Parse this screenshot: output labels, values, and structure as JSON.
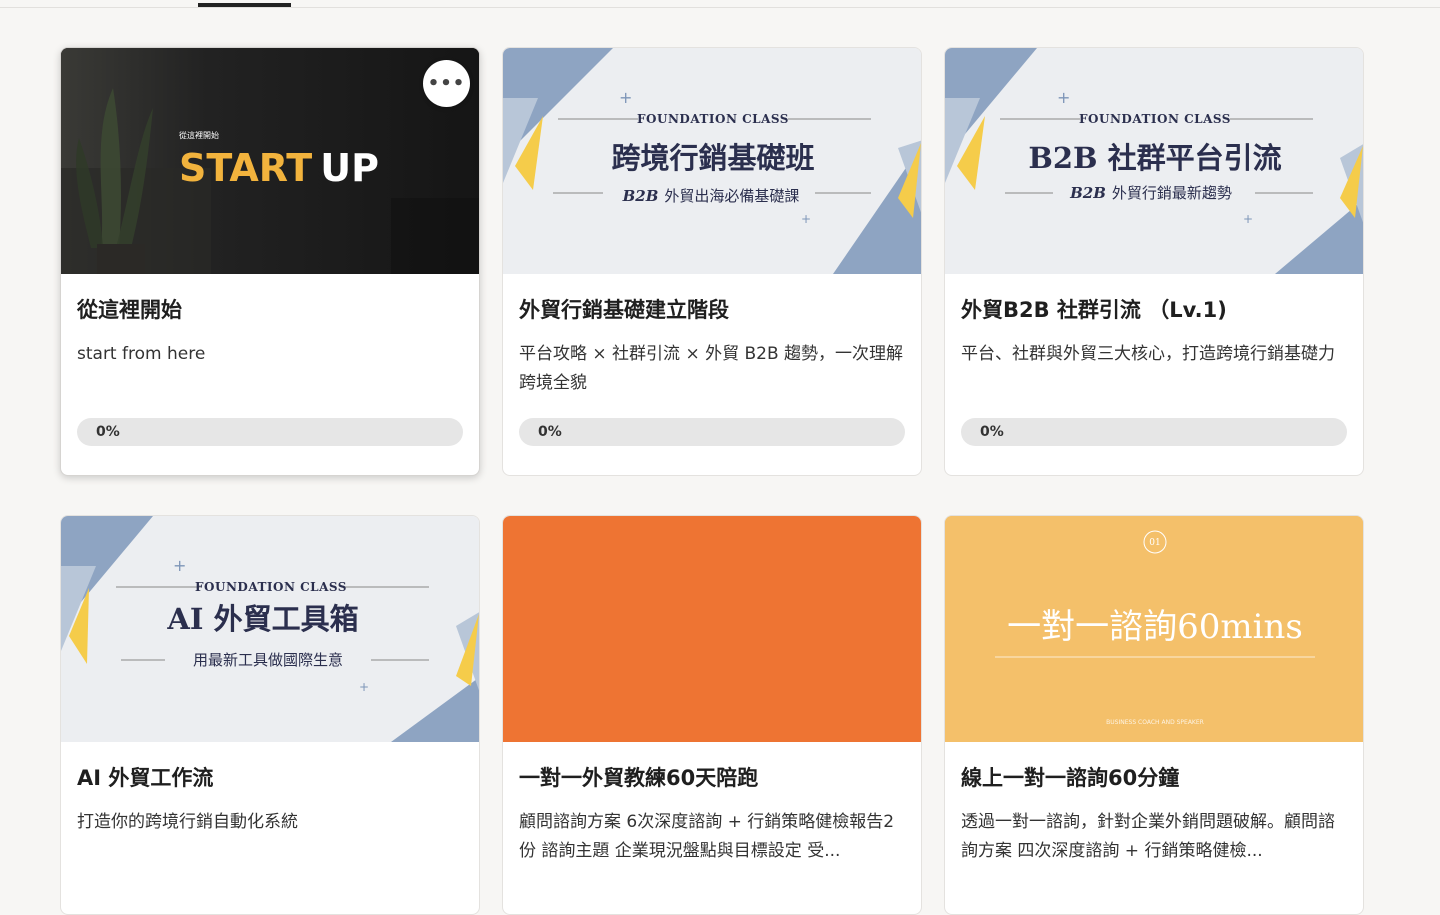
{
  "courses": [
    {
      "title": "從這裡開始",
      "description": "start from here",
      "progress_label": "0%",
      "progress": 0,
      "more_label": "•••",
      "thumb": {
        "kicker": "從這裡開始",
        "word1": "START",
        "word2": "UP"
      }
    },
    {
      "title": "外貿行銷基礎建立階段",
      "description": "平台攻略 × 社群引流 × 外貿 B2B 趨勢，一次理解跨境全貌",
      "progress_label": "0%",
      "progress": 0,
      "thumb": {
        "kicker": "FOUNDATION CLASS",
        "headline": "跨境行銷基礎班",
        "sub_bold": "B2B",
        "sub": "外貿出海必備基礎課"
      }
    },
    {
      "title": "外貿B2B 社群引流 （Lv.1)",
      "description": "平台、社群與外貿三大核心，打造跨境行銷基礎力",
      "progress_label": "0%",
      "progress": 0,
      "thumb": {
        "kicker": "FOUNDATION CLASS",
        "headline": "B2B 社群平台引流",
        "sub_bold": "B2B",
        "sub": "外貿行銷最新趨勢"
      }
    },
    {
      "title": "AI 外貿工作流",
      "description": "打造你的跨境行銷自動化系統",
      "thumb": {
        "kicker": "FOUNDATION CLASS",
        "headline": "AI 外貿工具箱",
        "sub": "用最新工具做國際生意"
      }
    },
    {
      "title": "一對一外貿教練60天陪跑",
      "description": "顧問諮詢方案 6次深度諮詢 + 行銷策略健檢報告2份 諮詢主題 企業現況盤點與目標設定 受...",
      "thumb": {}
    },
    {
      "title": "線上一對一諮詢60分鐘",
      "description": "透過一對一諮詢，針對企業外銷問題破解。顧問諮詢方案 四次深度諮詢 + 行銷策略健檢...",
      "thumb": {
        "badge": "01",
        "headline": "一對一諮詢60mins",
        "footer": "BUSINESS COACH AND SPEAKER"
      }
    }
  ],
  "colors": {
    "accent_gold": "#f2b33d",
    "orange": "#ee7433",
    "peach": "#f4c06a",
    "navy": "#2b2f4e",
    "slate_blue": "#8ea4c2",
    "yellow": "#f5cc4a"
  }
}
